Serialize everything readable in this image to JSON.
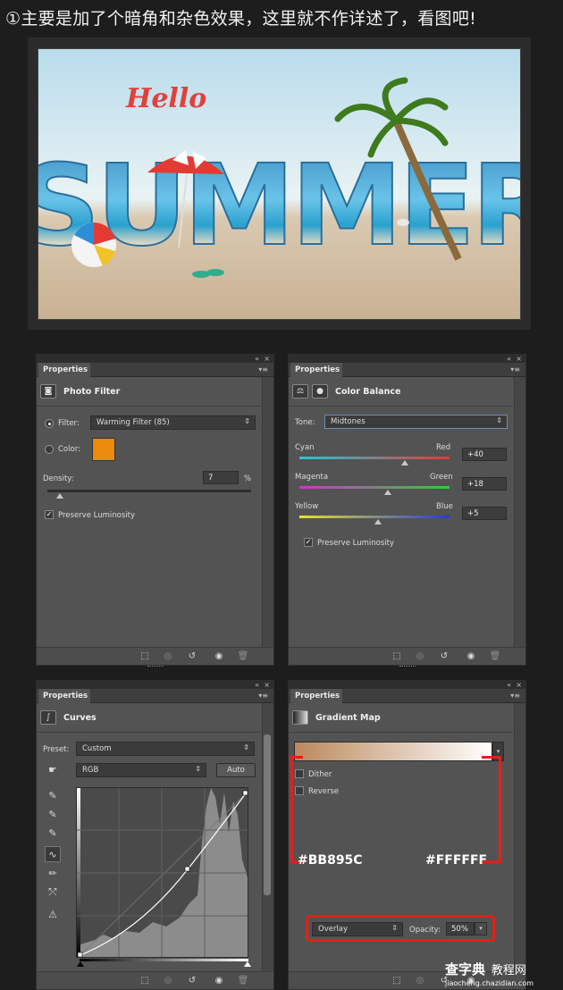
{
  "caption": "①主要是加了个暗角和杂色效果，这里就不作详述了，看图吧!",
  "hero": {
    "small_text": "Hello",
    "big_text": "SUMMER"
  },
  "panels": {
    "photo_filter": {
      "tab": "Properties",
      "title": "Photo Filter",
      "filter_label": "Filter:",
      "filter_value": "Warming Filter (85)",
      "color_label": "Color:",
      "swatch_color": "#EC8A0C",
      "density_label": "Density:",
      "density_value": "7",
      "density_unit": "%",
      "density_level": 0.07,
      "preserve_label": "Preserve Luminosity"
    },
    "color_balance": {
      "tab": "Properties",
      "title": "Color Balance",
      "tone_label": "Tone:",
      "tone_value": "Midtones",
      "rows": [
        {
          "left": "Cyan",
          "right": "Red",
          "value": "+40"
        },
        {
          "left": "Magenta",
          "right": "Green",
          "value": "+18"
        },
        {
          "left": "Yellow",
          "right": "Blue",
          "value": "+5"
        }
      ],
      "preserve_label": "Preserve Luminosity"
    },
    "curves": {
      "tab": "Properties",
      "title": "Curves",
      "preset_label": "Preset:",
      "preset_value": "Custom",
      "channel_value": "RGB",
      "auto_label": "Auto"
    },
    "gradient_map": {
      "tab": "Properties",
      "title": "Gradient Map",
      "dither_label": "Dither",
      "reverse_label": "Reverse",
      "start_color": "#BB895C",
      "end_color": "#FFFFFF",
      "start_hex": "#BB895C",
      "end_hex": "#FFFFFF",
      "blend_value": "Overlay",
      "opacity_label": "Opacity:",
      "opacity_value": "50%"
    }
  },
  "watermark": {
    "brand": "查字典",
    "site": "教程网",
    "url": "jiaocheng.chazidian.com"
  }
}
